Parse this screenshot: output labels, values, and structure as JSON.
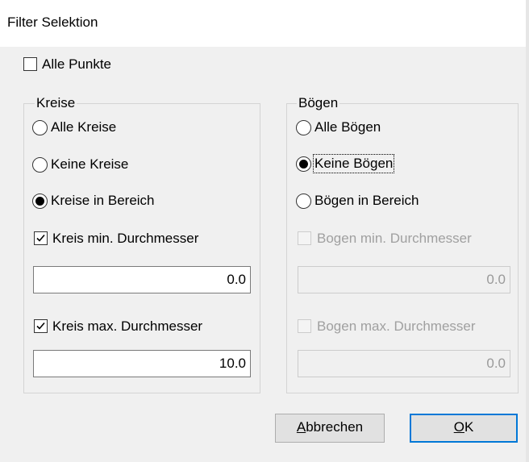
{
  "window": {
    "title": "Filter Selektion"
  },
  "all_points": {
    "label": "Alle Punkte",
    "checked": false
  },
  "circles": {
    "group_label": "Kreise",
    "options": [
      {
        "label": "Alle Kreise",
        "selected": false
      },
      {
        "label": "Keine Kreise",
        "selected": false
      },
      {
        "label": "Kreise in Bereich",
        "selected": true
      }
    ],
    "min_diameter": {
      "label": "Kreis min. Durchmesser",
      "checked": true,
      "enabled": true,
      "value": "0.0"
    },
    "max_diameter": {
      "label": "Kreis max. Durchmesser",
      "checked": true,
      "enabled": true,
      "value": "10.0"
    }
  },
  "arcs": {
    "group_label": "Bögen",
    "options": [
      {
        "label": "Alle Bögen",
        "selected": false
      },
      {
        "label": "Keine Bögen",
        "selected": true
      },
      {
        "label": "Bögen in Bereich",
        "selected": false
      }
    ],
    "min_diameter": {
      "label": "Bogen min. Durchmesser",
      "checked": false,
      "enabled": false,
      "value": "0.0"
    },
    "max_diameter": {
      "label": "Bogen max. Durchmesser",
      "checked": false,
      "enabled": false,
      "value": "0.0"
    }
  },
  "buttons": {
    "cancel": {
      "mnemonic": "A",
      "rest": "bbrechen"
    },
    "ok": {
      "mnemonic": "O",
      "rest": "K"
    }
  },
  "icons": {
    "checkmark": "checkmark-icon",
    "radio_dot": "radio-dot-icon"
  }
}
